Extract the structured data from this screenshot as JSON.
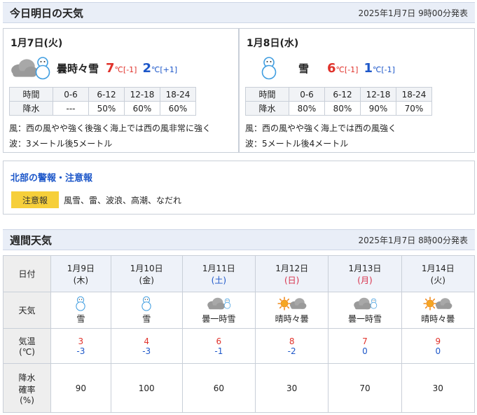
{
  "today": {
    "title": "今日明日の天気",
    "issued": "2025年1月7日 9時00分発表"
  },
  "days": [
    {
      "date": "1月7日(火)",
      "weather": "曇時々雪",
      "icons": [
        "cloud-icon",
        "snowman-icon"
      ],
      "high": "7",
      "high_diff": "℃[-1]",
      "low": "2",
      "low_diff": "℃[+1]",
      "rain_table": {
        "header": [
          "時間",
          "0-6",
          "6-12",
          "12-18",
          "18-24"
        ],
        "row": [
          "降水",
          "---",
          "50%",
          "60%",
          "60%"
        ]
      },
      "wind": "風：西の風やや強く後強く海上では西の風非常に強く",
      "wave": "波：3メートル後5メートル"
    },
    {
      "date": "1月8日(水)",
      "weather": "雪",
      "icons": [
        "snowman-icon"
      ],
      "high": "6",
      "high_diff": "℃[-1]",
      "low": "1",
      "low_diff": "℃[-1]",
      "rain_table": {
        "header": [
          "時間",
          "0-6",
          "6-12",
          "12-18",
          "18-24"
        ],
        "row": [
          "降水",
          "80%",
          "80%",
          "90%",
          "70%"
        ]
      },
      "wind": "風：西の風やや強く海上では西の風強く",
      "wave": "波：5メートル後4メートル"
    }
  ],
  "warning": {
    "title": "北部の警報・注意報",
    "badge": "注意報",
    "items": "風雪、雷、波浪、高潮、なだれ",
    "badge_color": "#f6cf3a"
  },
  "weekly": {
    "title": "週間天気",
    "issued": "2025年1月7日 8時00分発表",
    "labels": {
      "date": "日付",
      "weather": "天気",
      "temp_1": "気温",
      "temp_2": "(℃)",
      "rain_1": "降水",
      "rain_2": "確率",
      "rain_3": "(%)"
    },
    "days": [
      {
        "date": "1月9日",
        "dow": "(木)",
        "dow_type": "weekday",
        "weather": "雪",
        "icon": "snowman-icon",
        "high": "3",
        "low": "-3",
        "rain": "90"
      },
      {
        "date": "1月10日",
        "dow": "(金)",
        "dow_type": "weekday",
        "weather": "雪",
        "icon": "snowman-icon",
        "high": "4",
        "low": "-3",
        "rain": "100"
      },
      {
        "date": "1月11日",
        "dow": "(土)",
        "dow_type": "sat",
        "weather": "曇一時雪",
        "icon": "cloud-snow-icon",
        "high": "6",
        "low": "-1",
        "rain": "60"
      },
      {
        "date": "1月12日",
        "dow": "(日)",
        "dow_type": "sun",
        "weather": "晴時々曇",
        "icon": "sun-cloud-icon",
        "high": "8",
        "low": "-2",
        "rain": "30"
      },
      {
        "date": "1月13日",
        "dow": "(月)",
        "dow_type": "sun",
        "weather": "曇一時雪",
        "icon": "cloud-snow-icon",
        "high": "7",
        "low": "0",
        "rain": "70"
      },
      {
        "date": "1月14日",
        "dow": "(火)",
        "dow_type": "weekday",
        "weather": "晴時々曇",
        "icon": "sun-cloud-icon",
        "high": "9",
        "low": "0",
        "rain": "30"
      }
    ]
  },
  "colors": {
    "high": "#e0322b",
    "low": "#1d57c9",
    "header_bg": "#e9eef7"
  }
}
